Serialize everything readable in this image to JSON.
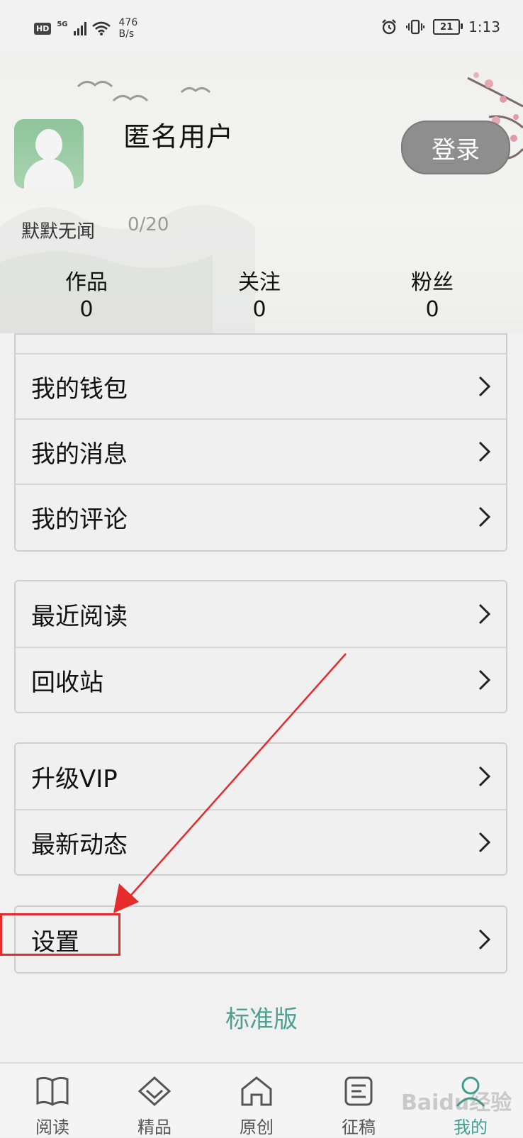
{
  "status_bar": {
    "hd": "HD",
    "network": "5G",
    "speed_value": "476",
    "speed_unit": "B/s",
    "battery": "21",
    "time": "1:13"
  },
  "profile": {
    "username": "匿名用户",
    "login_label": "登录",
    "signature": "默默无闻",
    "signature_count": "0/20",
    "stats": [
      {
        "label": "作品",
        "value": "0"
      },
      {
        "label": "关注",
        "value": "0"
      },
      {
        "label": "粉丝",
        "value": "0"
      }
    ]
  },
  "menu": {
    "group1": [
      "我的钱包",
      "我的消息",
      "我的评论"
    ],
    "group2": [
      "最近阅读",
      "回收站"
    ],
    "group3": [
      "升级VIP",
      "最新动态"
    ],
    "group4": [
      "设置"
    ]
  },
  "version_label": "标准版",
  "bottom_nav": [
    {
      "label": "阅读",
      "icon": "book-icon"
    },
    {
      "label": "精品",
      "icon": "diamond-icon"
    },
    {
      "label": "原创",
      "icon": "home-icon"
    },
    {
      "label": "征稿",
      "icon": "document-icon"
    },
    {
      "label": "我的",
      "icon": "person-icon",
      "active": true
    }
  ],
  "watermark": "Baidu经验",
  "colors": {
    "accent": "#3e9f8e",
    "annotation": "#e52b2b",
    "login_button": "#8e8e8e"
  }
}
